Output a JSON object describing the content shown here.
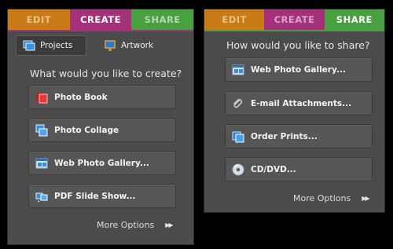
{
  "left_panel": {
    "tabs": {
      "edit": "EDIT",
      "create": "CREATE",
      "share": "SHARE"
    },
    "subtabs": {
      "projects": "Projects",
      "artwork": "Artwork"
    },
    "heading": "What would you like to create?",
    "options": {
      "photo_book": "Photo Book",
      "photo_collage": "Photo Collage",
      "web_gallery": "Web Photo Gallery...",
      "pdf_slideshow": "PDF Slide Show..."
    },
    "more_options": "More Options"
  },
  "right_panel": {
    "tabs": {
      "edit": "EDIT",
      "create": "CREATE",
      "share": "SHARE"
    },
    "heading": "How would you like to share?",
    "options": {
      "web_gallery": "Web Photo Gallery...",
      "email": "E-mail Attachments...",
      "order_prints": "Order Prints...",
      "cd_dvd": "CD/DVD..."
    },
    "more_options": "More Options"
  },
  "colors": {
    "edit_tab": "#c97b17",
    "create_tab": "#a5317a",
    "share_tab": "#48a040",
    "panel_bg": "#4b4b4b"
  }
}
